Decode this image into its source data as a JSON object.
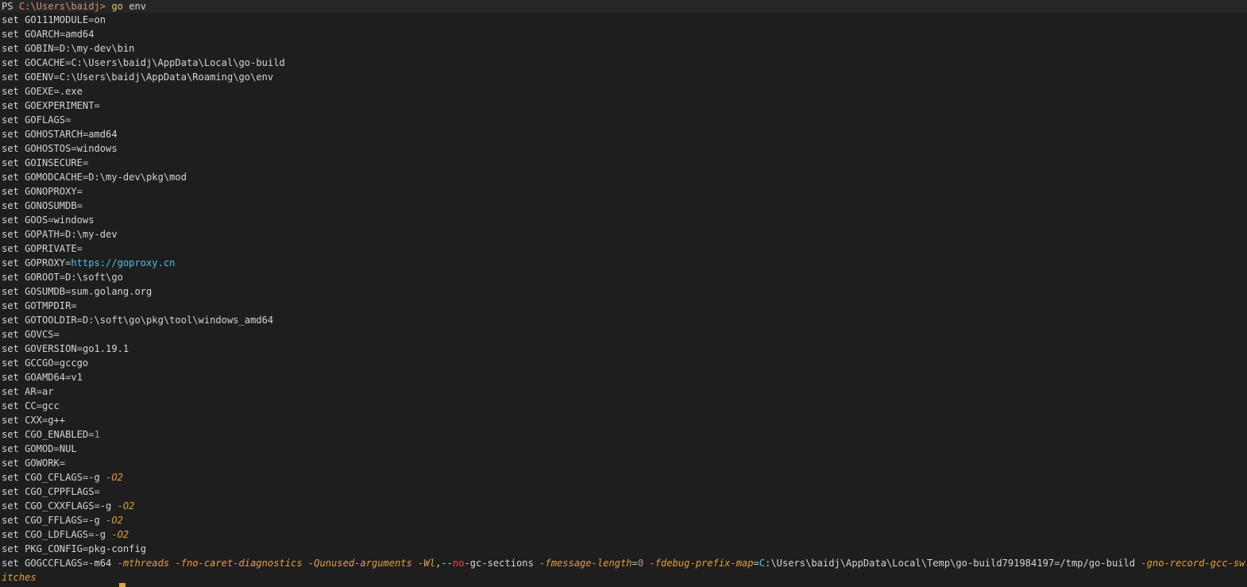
{
  "prompt": {
    "ps": "PS",
    "path": "C:\\Users\\baidj>",
    "command": "go",
    "arg": "env"
  },
  "set_keyword": "set",
  "env": [
    {
      "name": "GO111MODULE",
      "value": "on"
    },
    {
      "name": "GOARCH",
      "value": "amd64"
    },
    {
      "name": "GOBIN",
      "value": "D:\\my-dev\\bin"
    },
    {
      "name": "GOCACHE",
      "value": "C:\\Users\\baidj\\AppData\\Local\\go-build"
    },
    {
      "name": "GOENV",
      "value": "C:\\Users\\baidj\\AppData\\Roaming\\go\\env"
    },
    {
      "name": "GOEXE",
      "value": ".exe"
    },
    {
      "name": "GOEXPERIMENT",
      "value": ""
    },
    {
      "name": "GOFLAGS",
      "value": ""
    },
    {
      "name": "GOHOSTARCH",
      "value": "amd64"
    },
    {
      "name": "GOHOSTOS",
      "value": "windows"
    },
    {
      "name": "GOINSECURE",
      "value": ""
    },
    {
      "name": "GOMODCACHE",
      "value": "D:\\my-dev\\pkg\\mod"
    },
    {
      "name": "GONOPROXY",
      "value": ""
    },
    {
      "name": "GONOSUMDB",
      "value": ""
    },
    {
      "name": "GOOS",
      "value": "windows"
    },
    {
      "name": "GOPATH",
      "value": "D:\\my-dev"
    },
    {
      "name": "GOPRIVATE",
      "value": ""
    },
    {
      "name": "GOPROXY",
      "value": "https://goproxy.cn",
      "kind": "url"
    },
    {
      "name": "GOROOT",
      "value": "D:\\soft\\go"
    },
    {
      "name": "GOSUMDB",
      "value": "sum.golang.org"
    },
    {
      "name": "GOTMPDIR",
      "value": ""
    },
    {
      "name": "GOTOOLDIR",
      "value": "D:\\soft\\go\\pkg\\tool\\windows_amd64"
    },
    {
      "name": "GOVCS",
      "value": ""
    },
    {
      "name": "GOVERSION",
      "value": "go1.19.1"
    },
    {
      "name": "GCCGO",
      "value": "gccgo"
    },
    {
      "name": "GOAMD64",
      "value": "v1"
    },
    {
      "name": "AR",
      "value": "ar"
    },
    {
      "name": "CC",
      "value": "gcc"
    },
    {
      "name": "CXX",
      "value": "g++"
    },
    {
      "name": "CGO_ENABLED",
      "value": "1",
      "kind": "num"
    },
    {
      "name": "GOMOD",
      "value": "NUL"
    },
    {
      "name": "GOWORK",
      "value": ""
    },
    {
      "name": "CGO_CFLAGS",
      "value": "-g",
      "flag": "-O2"
    },
    {
      "name": "CGO_CPPFLAGS",
      "value": ""
    },
    {
      "name": "CGO_CXXFLAGS",
      "value": "-g",
      "flag": "-O2"
    },
    {
      "name": "CGO_FFLAGS",
      "value": "-g",
      "flag": "-O2"
    },
    {
      "name": "CGO_LDFLAGS",
      "value": "-g",
      "flag": "-O2"
    },
    {
      "name": "PKG_CONFIG",
      "value": "pkg-config"
    }
  ],
  "gogccflags": {
    "name": "GOGCCFLAGS",
    "parts": [
      {
        "t": "-m64 ",
        "c": "val"
      },
      {
        "t": "-mthreads ",
        "c": "flag"
      },
      {
        "t": "-fno-caret-diagnostics ",
        "c": "flag"
      },
      {
        "t": "-Qunused-arguments ",
        "c": "flag"
      },
      {
        "t": "-Wl",
        "c": "flag"
      },
      {
        "t": ",",
        "c": "val"
      },
      {
        "t": "--",
        "c": "eq"
      },
      {
        "t": "no",
        "c": "flagred"
      },
      {
        "t": "-gc-sections ",
        "c": "val"
      },
      {
        "t": "-fmessage-length",
        "c": "flag"
      },
      {
        "t": "=",
        "c": "eq"
      },
      {
        "t": "0 ",
        "c": "num"
      },
      {
        "t": "-fdebug-prefix-map",
        "c": "flag"
      },
      {
        "t": "=",
        "c": "eq"
      },
      {
        "t": "C",
        "c": "url"
      },
      {
        "t": ":\\Users\\baidj\\AppData\\Local\\Temp\\go-build791984197",
        "c": "val"
      },
      {
        "t": "=",
        "c": "eq"
      },
      {
        "t": "/tmp/go-build ",
        "c": "val"
      },
      {
        "t": "-gno-record-gcc-switches",
        "c": "flag"
      }
    ]
  }
}
